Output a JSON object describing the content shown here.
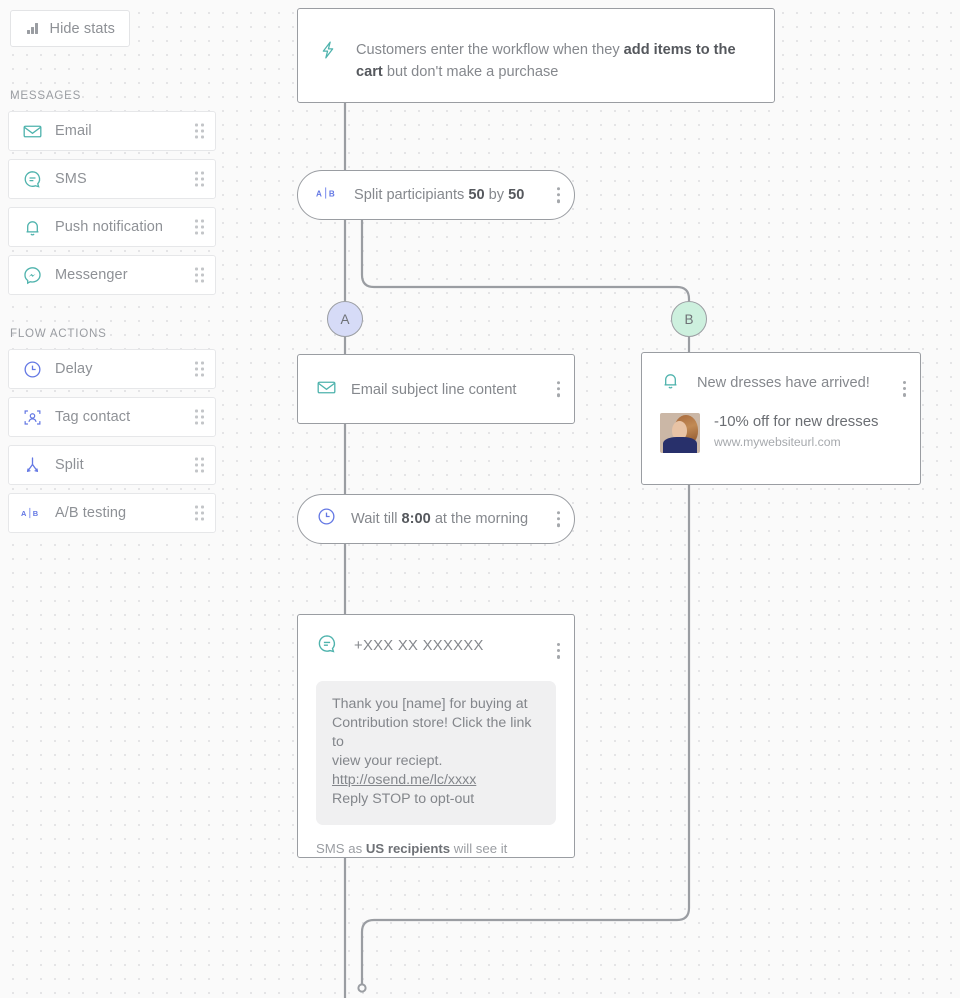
{
  "toolbar": {
    "hide_stats_label": "Hide stats",
    "hide_stats_icon": "bar-chart-icon"
  },
  "sidebar": {
    "sections": [
      {
        "title": "MESSAGES",
        "items": [
          {
            "label": "Email",
            "icon": "envelope-icon",
            "color": "#4fb3ad"
          },
          {
            "label": "SMS",
            "icon": "sms-bubble-icon",
            "color": "#4fb3ad"
          },
          {
            "label": "Push notification",
            "icon": "bell-icon",
            "color": "#4fb3ad"
          },
          {
            "label": "Messenger",
            "icon": "messenger-icon",
            "color": "#4fb3ad"
          }
        ]
      },
      {
        "title": "FLOW ACTIONS",
        "items": [
          {
            "label": "Delay",
            "icon": "clock-icon",
            "color": "#6478e4"
          },
          {
            "label": "Tag contact",
            "icon": "tag-contact-icon",
            "color": "#6478e4"
          },
          {
            "label": "Split",
            "icon": "split-icon",
            "color": "#6478e4"
          },
          {
            "label": "A/B testing",
            "icon": "ab-testing-icon",
            "color": "#6478e4"
          }
        ]
      }
    ]
  },
  "flow": {
    "trigger": {
      "icon": "lightning-bolt-icon",
      "text_plain": "Customers enter the workflow when they ",
      "text_bold": "add items to the cart",
      "text_tail": " but don't make a purchase"
    },
    "split": {
      "icon": "ab-testing-icon",
      "label_lead": "Split participiants ",
      "label_a": "50",
      "label_mid": " by ",
      "label_b": "50"
    },
    "branch_a_label": "A",
    "branch_b_label": "B",
    "email_node": {
      "icon": "envelope-icon",
      "label": "Email subject line content"
    },
    "push_node": {
      "icon": "bell-icon",
      "header": "New dresses have arrived!",
      "title": "-10% off for new dresses",
      "url": "www.mywebsiteurl.com",
      "thumbnail": "woman-photo-thumbnail"
    },
    "wait_node": {
      "icon": "clock-icon",
      "label_lead": "Wait till ",
      "label_time": "8:00",
      "label_tail": " at the morning"
    },
    "sms_node": {
      "icon": "sms-bubble-icon",
      "phone": "+XXX XX XXXXXX",
      "body_line1": "Thank you [name] for buying at",
      "body_line2": "Contribution store! Click the link to",
      "body_line3": "view your reciept.",
      "body_link": "http://osend.me/lc/xxxx",
      "body_line5": "Reply STOP to opt-out",
      "footer_lead": "SMS as ",
      "footer_bold": "US recipients",
      "footer_tail": " will see it"
    },
    "menu_icon": "kebab-menu-icon"
  },
  "colors": {
    "accent_teal": "#4fb3ad",
    "accent_blue": "#6478e4",
    "branch_a_fill": "#d6dbf7",
    "branch_b_fill": "#cdf0de",
    "wire": "#9a9da2",
    "canvas_bg": "#fafafa"
  }
}
